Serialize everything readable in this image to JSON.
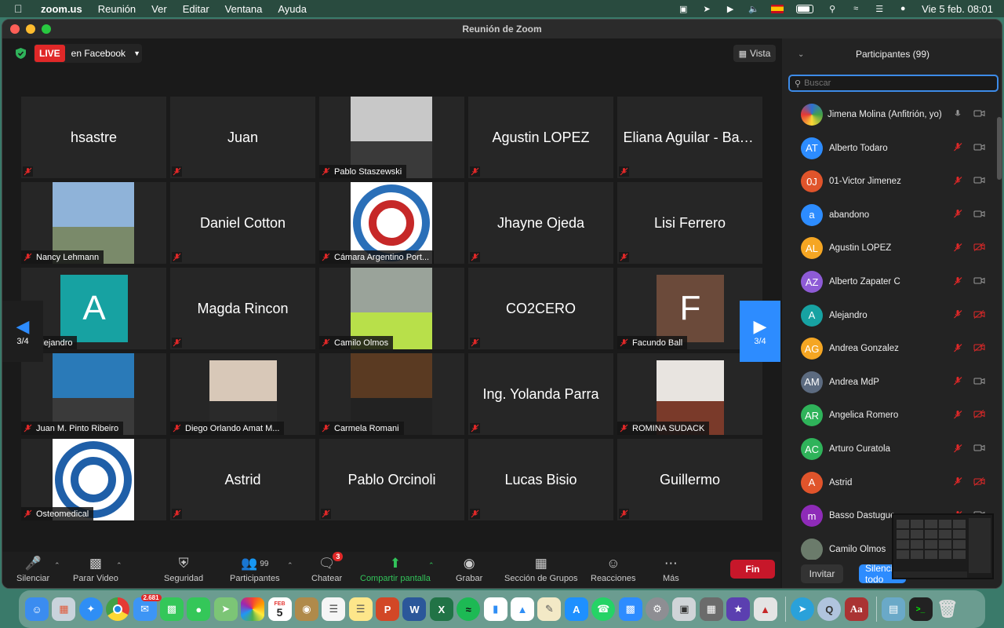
{
  "menubar": {
    "app_name": "zoom.us",
    "items": [
      "Reunión",
      "Ver",
      "Editar",
      "Ventana",
      "Ayuda"
    ],
    "clock": "Vie 5 feb.  08:01"
  },
  "window": {
    "title": "Reunión de Zoom",
    "live_badge": "LIVE",
    "live_label": "en Facebook",
    "vista_label": "Vista"
  },
  "grid": {
    "page_indicator": "3/4",
    "tiles": [
      {
        "name": "hsastre",
        "kind": "name"
      },
      {
        "name": "Juan",
        "kind": "name"
      },
      {
        "name": "Pablo Staszewski",
        "kind": "video"
      },
      {
        "name": "Agustin LOPEZ",
        "kind": "name"
      },
      {
        "name": "Eliana Aguilar - Ban...",
        "kind": "name"
      },
      {
        "name": "Nancy Lehmann",
        "kind": "video"
      },
      {
        "name": "Daniel Cotton",
        "kind": "name"
      },
      {
        "name": "Cámara Argentino Port...",
        "kind": "video"
      },
      {
        "name": "Jhayne Ojeda",
        "kind": "name"
      },
      {
        "name": "Lisi Ferrero",
        "kind": "name"
      },
      {
        "name": "Alejandro",
        "kind": "letter",
        "letter": "A"
      },
      {
        "name": "Magda Rincon",
        "kind": "name"
      },
      {
        "name": "Camilo Olmos",
        "kind": "video"
      },
      {
        "name": "CO2CERO",
        "kind": "name"
      },
      {
        "name": "Facundo Ball",
        "kind": "letter",
        "letter": "F"
      },
      {
        "name": "Juan M. Pinto Ribeiro",
        "kind": "video"
      },
      {
        "name": "Diego Orlando Amat M...",
        "kind": "video"
      },
      {
        "name": "Carmela Romani",
        "kind": "video"
      },
      {
        "name": "Ing. Yolanda Parra",
        "kind": "name"
      },
      {
        "name": "ROMINA SUDACK",
        "kind": "video"
      },
      {
        "name": "Osteomedical",
        "kind": "video"
      },
      {
        "name": "Astrid",
        "kind": "name"
      },
      {
        "name": "Pablo Orcinoli",
        "kind": "name"
      },
      {
        "name": "Lucas Bisio",
        "kind": "name"
      },
      {
        "name": "Guillermo",
        "kind": "name"
      }
    ]
  },
  "toolbar": {
    "silenciar": "Silenciar",
    "parar_video": "Parar Video",
    "seguridad": "Seguridad",
    "participantes": "Participantes",
    "participant_count": "99",
    "chatear": "Chatear",
    "chat_badge": "3",
    "compartir": "Compartir pantalla",
    "grabar": "Grabar",
    "grupos": "Sección de Grupos",
    "reacciones": "Reacciones",
    "mas": "Más",
    "fin": "Fin"
  },
  "panel": {
    "title": "Participantes (99)",
    "search_placeholder": "Buscar",
    "invite": "Invitar",
    "mute_all": "Silenciar todo",
    "participants": [
      {
        "name": "Jimena Molina  (Anfitrión, yo)",
        "initials": "",
        "color": "#2f6fd1",
        "mic": "on",
        "cam": "on"
      },
      {
        "name": "Alberto Todaro",
        "initials": "AT",
        "color": "#2d8cff",
        "mic": "off",
        "cam": "on"
      },
      {
        "name": "01-Victor Jimenez",
        "initials": "0J",
        "color": "#e0542b",
        "mic": "off",
        "cam": "on"
      },
      {
        "name": "abandono",
        "initials": "a",
        "color": "#2d8cff",
        "mic": "off",
        "cam": "on"
      },
      {
        "name": "Agustin LOPEZ",
        "initials": "AL",
        "color": "#f5a623",
        "mic": "off",
        "cam": "off"
      },
      {
        "name": "Alberto Zapater C",
        "initials": "AZ",
        "color": "#8e5bd6",
        "mic": "off",
        "cam": "on"
      },
      {
        "name": "Alejandro",
        "initials": "A",
        "color": "#17a2a2",
        "mic": "off",
        "cam": "off"
      },
      {
        "name": "Andrea Gonzalez",
        "initials": "AG",
        "color": "#f5a623",
        "mic": "off",
        "cam": "off"
      },
      {
        "name": "Andrea MdP",
        "initials": "AM",
        "color": "#5c6b80",
        "mic": "off",
        "cam": "on"
      },
      {
        "name": "Angelica Romero",
        "initials": "AR",
        "color": "#2fb35a",
        "mic": "off",
        "cam": "off"
      },
      {
        "name": "Arturo Curatola",
        "initials": "AC",
        "color": "#2fb35a",
        "mic": "off",
        "cam": "on"
      },
      {
        "name": "Astrid",
        "initials": "A",
        "color": "#e0542b",
        "mic": "off",
        "cam": "off"
      },
      {
        "name": "Basso Dastugue",
        "initials": "m",
        "color": "#8e2bb8",
        "mic": "off",
        "cam": "on"
      },
      {
        "name": "Camilo Olmos",
        "initials": "",
        "color": "#6b7b6b",
        "mic": "off",
        "cam": "on"
      }
    ]
  },
  "dock": {
    "mail_badge": "2.681",
    "calendar_month": "FEB",
    "calendar_day": "5"
  }
}
